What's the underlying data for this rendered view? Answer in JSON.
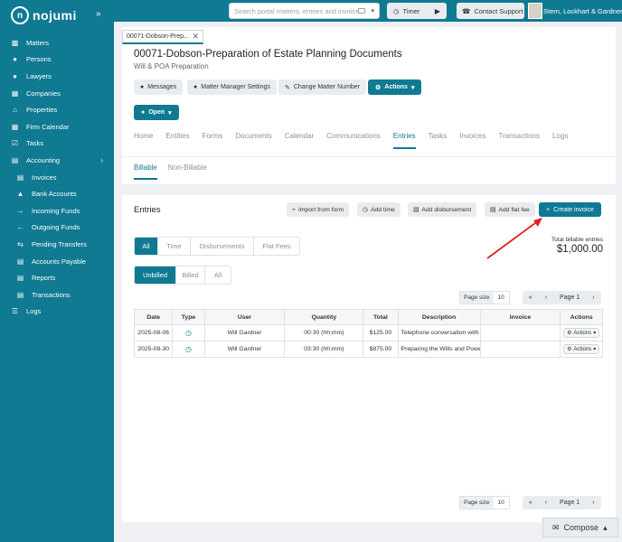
{
  "sidebar": {
    "logo": "nojumi",
    "items": [
      {
        "label": "Matters",
        "icon": "briefcase-icon"
      },
      {
        "label": "Persons",
        "icon": "users-icon"
      },
      {
        "label": "Lawyers",
        "icon": "user-tie-icon"
      },
      {
        "label": "Companies",
        "icon": "building-icon"
      },
      {
        "label": "Properties",
        "icon": "house-icon"
      },
      {
        "label": "Firm Calendar",
        "icon": "calendar-icon"
      },
      {
        "label": "Tasks",
        "icon": "checkbox-icon"
      },
      {
        "label": "Accounting",
        "icon": "ledger-icon"
      },
      {
        "label": "Invoices",
        "icon": "file-invoice-icon"
      },
      {
        "label": "Bank Accounts",
        "icon": "bank-icon"
      },
      {
        "label": "Incoming Funds",
        "icon": "arrow-right-icon"
      },
      {
        "label": "Outgoing Funds",
        "icon": "arrow-left-icon"
      },
      {
        "label": "Pending Transfers",
        "icon": "transfer-icon"
      },
      {
        "label": "Accounts Payable",
        "icon": "file-invoice-icon"
      },
      {
        "label": "Reports",
        "icon": "report-icon"
      },
      {
        "label": "Transactions",
        "icon": "transactions-icon"
      },
      {
        "label": "Logs",
        "icon": "logs-icon"
      }
    ]
  },
  "header": {
    "search_placeholder": "Search portal matters, entries and invoices",
    "timer_label": "Timer",
    "contact_label": "Contact Support",
    "firm_name": "Stern, Lockhart & Gardner"
  },
  "matter": {
    "tab_label": "00071-Dobson-Prep...",
    "title": "00071-Dobson-Preparation of Estate Planning Documents",
    "subtitle": "Will & POA Preparation",
    "buttons": {
      "messages": "Messages",
      "settings": "Matter Manager Settings",
      "change_number": "Change Matter Number",
      "actions": "Actions",
      "status": "Open"
    },
    "tabs": [
      "Home",
      "Entities",
      "Forms",
      "Documents",
      "Calendar",
      "Communications",
      "Entries",
      "Tasks",
      "Invoices",
      "Transactions",
      "Logs"
    ]
  },
  "billing_tabs": [
    "Billable",
    "Non-Billable"
  ],
  "entries": {
    "title": "Entries",
    "buttons": {
      "import": "Import from form",
      "add_time": "Add time",
      "add_disbursement": "Add disbursement",
      "add_flat_fee": "Add flat fee",
      "create_invoice": "Create invoice"
    },
    "type_filters": [
      "All",
      "Time",
      "Disbursements",
      "Flat Fees"
    ],
    "status_filters": [
      "Unbilled",
      "Billed",
      "All"
    ],
    "total_label": "Total billable entries",
    "total_value": "$1,000.00",
    "page_size_label": "Page size",
    "page_size_value": "10",
    "page_label": "Page 1",
    "columns": [
      "Date",
      "Type",
      "User",
      "Quantity",
      "Total",
      "Description",
      "Invoice",
      "Actions"
    ],
    "rows": [
      {
        "date": "2025-08-06",
        "user": "Will Gardner",
        "quantity": "00:30 (hh:mm)",
        "total": "$125.00",
        "description": "Telephone conversation with th",
        "invoice": "",
        "actions": "Actions"
      },
      {
        "date": "2025-08-30",
        "user": "Will Gardner",
        "quantity": "03:30 (hh:mm)",
        "total": "$875.00",
        "description": "Preparing the Wills and Power",
        "invoice": "",
        "actions": "Actions"
      }
    ]
  },
  "compose_label": "Compose",
  "colors": {
    "brand": "#0f7a92",
    "arrow": "#e02020"
  }
}
